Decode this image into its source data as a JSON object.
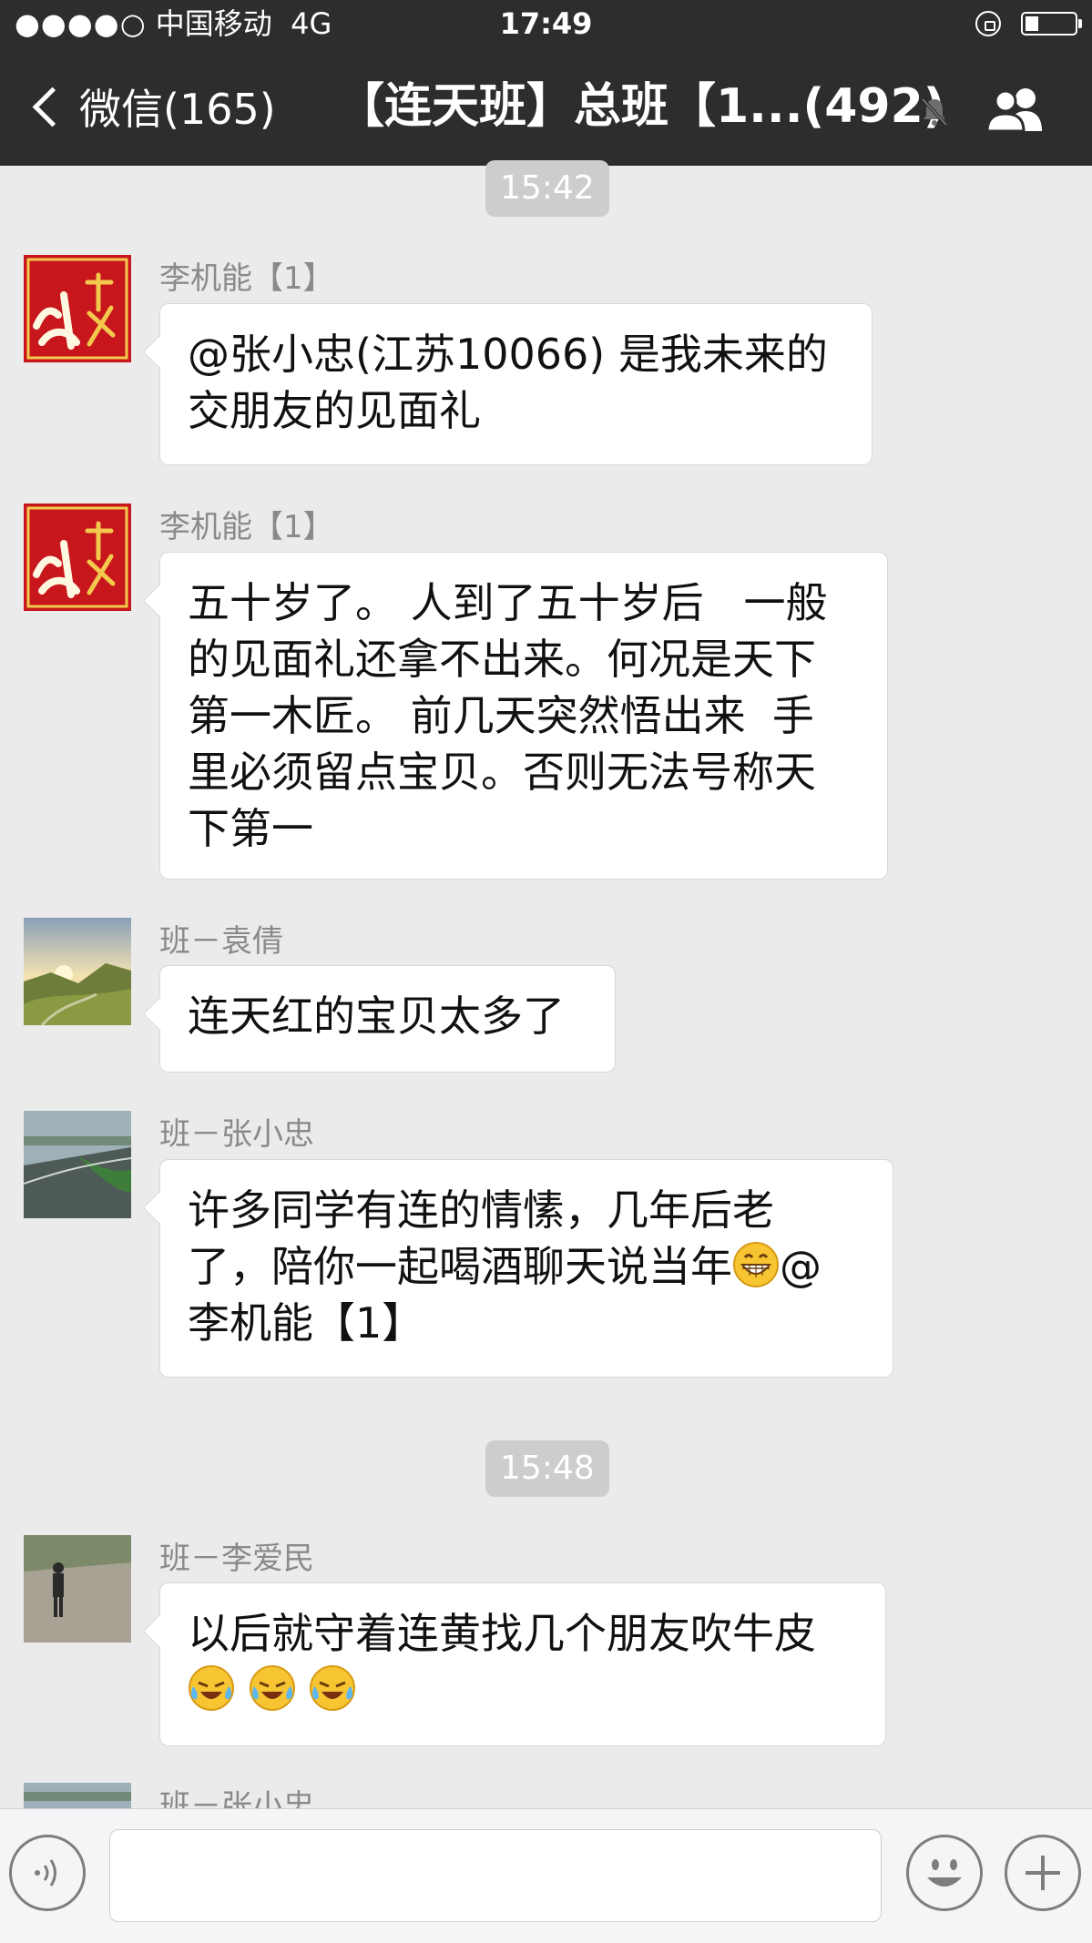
{
  "status_bar": {
    "signal": "●●●●○",
    "carrier": "中国移动",
    "network": "4G",
    "time": "17:49",
    "icons": [
      "orientation-lock-icon",
      "battery-icon"
    ],
    "battery_level": 0.25
  },
  "nav": {
    "back_label": "微信(165)",
    "title": "【连天班】总班【1...(492)",
    "icons": [
      "mute-bell-icon",
      "group-members-icon"
    ]
  },
  "chat": {
    "timestamps": [
      "15:42",
      "15:48"
    ],
    "messages": [
      {
        "sender": "李机能【1】",
        "lines": [
          "@张小忠(江苏10066) 是我未来的",
          "交朋友的见面礼"
        ]
      },
      {
        "sender": "李机能【1】",
        "lines": [
          "五十岁了。 人到了五十岁后   一般",
          "的见面礼还拿不出来。何况是天下",
          "第一木匠。 前几天突然悟出来  手",
          "里必须留点宝贝。否则无法号称天",
          "下第一"
        ]
      },
      {
        "sender": "班－袁倩",
        "lines": [
          "连天红的宝贝太多了"
        ]
      },
      {
        "sender": "班－张小忠",
        "lines": [
          "许多同学有连的情愫，几年后老",
          "了，陪你一起喝酒聊天说当年",
          "@",
          "李机能【1】"
        ],
        "emoji": "grinning-face-emoji"
      },
      {
        "sender": "班－李爱民",
        "lines": [
          "以后就守着连黄找几个朋友吹牛皮"
        ],
        "emoji": "crying-laughing-emoji"
      },
      {
        "sender": "班－张小忠"
      }
    ]
  },
  "input_bar": {
    "icons": [
      "voice-icon",
      "emoji-icon",
      "plus-icon"
    ],
    "text_value": ""
  },
  "colors": {
    "nav_bg": "#2d2d30",
    "chat_bg": "#ebebeb",
    "avatar_red": "#c8161d"
  }
}
